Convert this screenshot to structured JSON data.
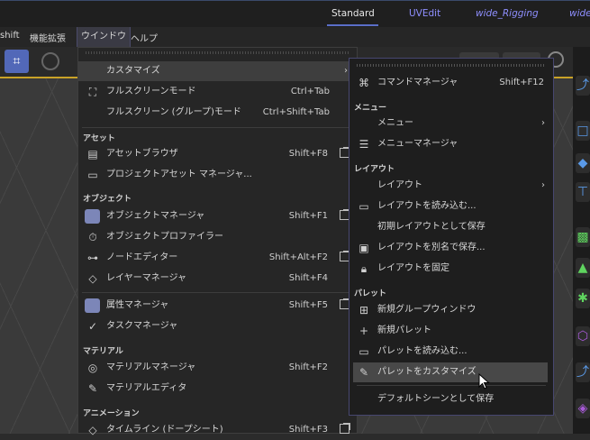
{
  "layouts": {
    "tabs": [
      "Standard",
      "UVEdit",
      "wide_Rigging",
      "wide"
    ]
  },
  "menubar": {
    "items": [
      "shift",
      "機能拡張",
      "ウインドウ",
      "ヘルプ"
    ]
  },
  "main_menu": {
    "customize": "カスタマイズ",
    "fullscreen": {
      "label": "フルスクリーンモード",
      "shortcut": "Ctrl+Tab"
    },
    "fullscreen_group": {
      "label": "フルスクリーン (グループ)モード",
      "shortcut": "Ctrl+Shift+Tab"
    },
    "section_asset": "アセット",
    "asset_browser": {
      "label": "アセットブラウザ",
      "shortcut": "Shift+F8"
    },
    "project_asset": {
      "label": "プロジェクトアセット マネージャ..."
    },
    "section_object": "オブジェクト",
    "object_manager": {
      "label": "オブジェクトマネージャ",
      "shortcut": "Shift+F1"
    },
    "object_profiler": {
      "label": "オブジェクトプロファイラー"
    },
    "node_editor": {
      "label": "ノードエディター",
      "shortcut": "Shift+Alt+F2"
    },
    "layer_manager": {
      "label": "レイヤーマネージャ",
      "shortcut": "Shift+F4"
    },
    "attribute_manager": {
      "label": "属性マネージャ",
      "shortcut": "Shift+F5"
    },
    "task_manager": {
      "label": "タスクマネージャ"
    },
    "section_material": "マテリアル",
    "material_manager": {
      "label": "マテリアルマネージャ",
      "shortcut": "Shift+F2"
    },
    "material_editor": {
      "label": "マテリアルエディタ"
    },
    "section_animation": "アニメーション",
    "timeline": {
      "label": "タイムライン (ドープシート)",
      "shortcut": "Shift+F3"
    }
  },
  "sub_menu": {
    "command_manager": {
      "label": "コマンドマネージャ",
      "shortcut": "Shift+F12"
    },
    "section_menu": "メニュー",
    "menu": "メニュー",
    "menu_manager": "メニューマネージャ",
    "section_layout": "レイアウト",
    "layout": "レイアウト",
    "load_layout": "レイアウトを読み込む...",
    "save_startup_layout": "初期レイアウトとして保存",
    "save_layout_as": "レイアウトを別名で保存...",
    "lock_layout": "レイアウトを固定",
    "section_palette": "パレット",
    "new_group_window": "新規グループウィンドウ",
    "new_palette": "新規パレット",
    "load_palette": "パレットを読み込む...",
    "customize_palette": "パレットをカスタマイズ",
    "save_default_scene": "デフォルトシーンとして保存"
  },
  "colors": {
    "accent": "#5268b8",
    "active_tab": "#5a6ec8",
    "layout_tab_text": "#8f8fff",
    "toolbar_highlight": "#c9a227",
    "palette_icon": "#5a9ae8"
  }
}
